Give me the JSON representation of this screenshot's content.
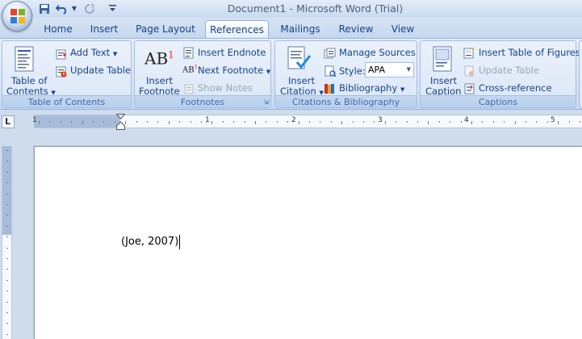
{
  "window": {
    "title": "Document1 - Microsoft Word (Trial)"
  },
  "tabs": [
    {
      "label": "Home",
      "active": false
    },
    {
      "label": "Insert",
      "active": false
    },
    {
      "label": "Page Layout",
      "active": false
    },
    {
      "label": "References",
      "active": true
    },
    {
      "label": "Mailings",
      "active": false
    },
    {
      "label": "Review",
      "active": false
    },
    {
      "label": "View",
      "active": false
    }
  ],
  "groups": {
    "toc": {
      "label": "Table of Contents",
      "table_of_contents_line1": "Table of",
      "table_of_contents_line2": "Contents",
      "add_text": "Add Text",
      "update_table": "Update Table"
    },
    "footnotes": {
      "label": "Footnotes",
      "insert_footnote_line1": "Insert",
      "insert_footnote_line2": "Footnote",
      "insert_endnote": "Insert Endnote",
      "next_footnote": "Next Footnote",
      "show_notes": "Show Notes",
      "ab_icon_text": "AB",
      "ab_sup": "1"
    },
    "citations": {
      "label": "Citations & Bibliography",
      "insert_citation_line1": "Insert",
      "insert_citation_line2": "Citation",
      "manage_sources": "Manage Sources",
      "style_label": "Style:",
      "style_value": "APA",
      "bibliography": "Bibliography"
    },
    "captions": {
      "label": "Captions",
      "insert_caption_line1": "Insert",
      "insert_caption_line2": "Caption",
      "insert_table_of_figures": "Insert Table of Figures",
      "update_table": "Update Table",
      "cross_reference": "Cross-reference"
    }
  },
  "ruler": {
    "numbers": [
      "1",
      "1",
      "2",
      "3",
      "4",
      "5"
    ],
    "corner_label": "L"
  },
  "document": {
    "text": "(Joe, 2007)"
  },
  "colors": {
    "accent": "#15428b",
    "ribbon": "#dbe7f6",
    "page": "#ffffff"
  }
}
